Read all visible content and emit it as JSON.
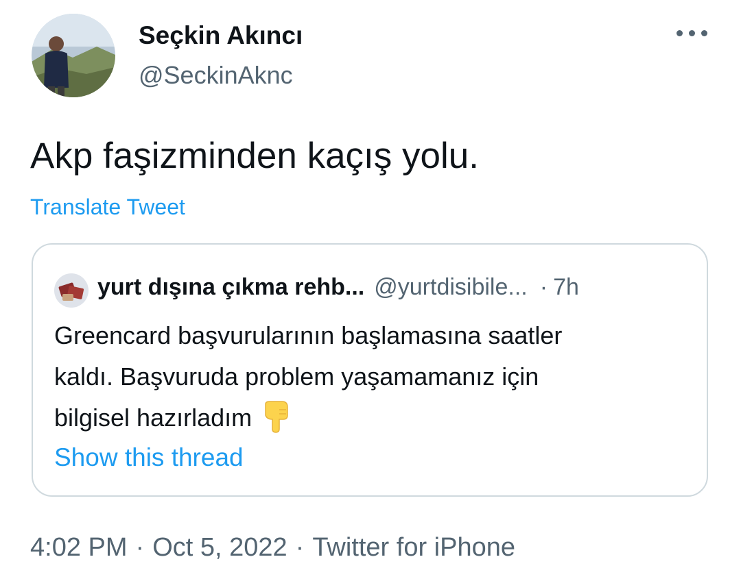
{
  "author": {
    "display_name": "Seçkin Akıncı",
    "handle": "@SeckinAknc",
    "avatar_icon": "user-avatar-photo"
  },
  "more_icon": "more-horizontal-icon",
  "tweet": {
    "text": "Akp faşizminden kaçış yolu.",
    "translate_label": "Translate Tweet"
  },
  "quoted_tweet": {
    "avatar_icon": "account-avatar-photo",
    "display_name": "yurt dışına çıkma rehb...",
    "handle": "@yurtdisibile...",
    "separator": "·",
    "time": "7h",
    "text_lines": [
      "Greencard başvurularının başlamasına saatler",
      "kaldı. Başvuruda problem yaşamamanız için",
      "bilgisel hazırladım"
    ],
    "emoji_icon": "backhand-index-pointing-down-emoji",
    "show_thread_label": "Show this thread"
  },
  "meta": {
    "time": "4:02 PM",
    "separator": "·",
    "date": "Oct 5, 2022",
    "source": "Twitter for iPhone"
  },
  "colors": {
    "link": "#1d9bf0",
    "secondary_text": "#536471",
    "primary_text": "#0f1419",
    "border": "#cfd9de"
  }
}
